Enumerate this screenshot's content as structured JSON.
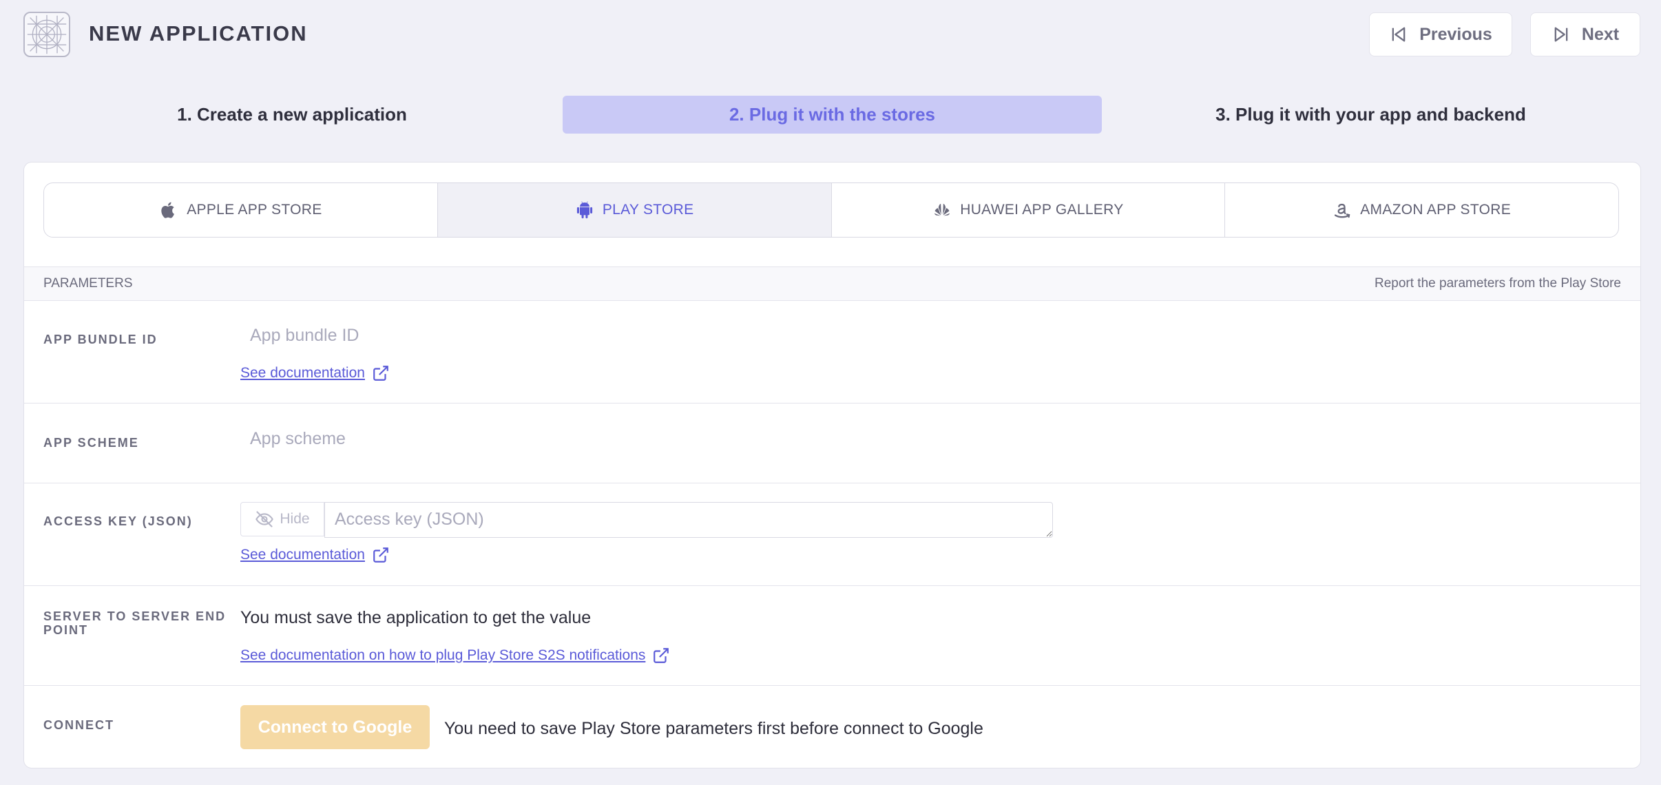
{
  "header": {
    "title": "NEW APPLICATION",
    "previous_label": "Previous",
    "next_label": "Next"
  },
  "steps": [
    {
      "label": "1. Create a new application",
      "active": false
    },
    {
      "label": "2. Plug it with the stores",
      "active": true
    },
    {
      "label": "3. Plug it with your app and backend",
      "active": false
    }
  ],
  "store_tabs": [
    {
      "label": "APPLE APP STORE",
      "icon": "apple-icon",
      "active": false
    },
    {
      "label": "PLAY STORE",
      "icon": "android-icon",
      "active": true
    },
    {
      "label": "HUAWEI APP GALLERY",
      "icon": "huawei-icon",
      "active": false
    },
    {
      "label": "AMAZON APP STORE",
      "icon": "amazon-icon",
      "active": false
    }
  ],
  "parameters": {
    "header_left": "PARAMETERS",
    "header_right": "Report the parameters from the Play Store"
  },
  "fields": {
    "bundle_id": {
      "label": "APP BUNDLE ID",
      "placeholder": "App bundle ID",
      "value": "",
      "doc_link": "See documentation"
    },
    "scheme": {
      "label": "APP SCHEME",
      "placeholder": "App scheme",
      "value": ""
    },
    "access_key": {
      "label": "ACCESS KEY (JSON)",
      "hide_label": "Hide",
      "placeholder": "Access key (JSON)",
      "value": "",
      "doc_link": "See documentation"
    },
    "s2s": {
      "label": "SERVER TO SERVER END POINT",
      "message": "You must save the application to get the value",
      "doc_link": "See documentation on how to plug Play Store S2S notifications"
    },
    "connect": {
      "label": "CONNECT",
      "button_label": "Connect to Google",
      "message": "You need to save Play Store parameters first before connect to Google"
    }
  },
  "colors": {
    "accent": "#5a5ad8",
    "active_step_bg": "#c9c9f6",
    "connect_button_bg": "#f5d9a4",
    "page_bg": "#f0f0f7"
  }
}
